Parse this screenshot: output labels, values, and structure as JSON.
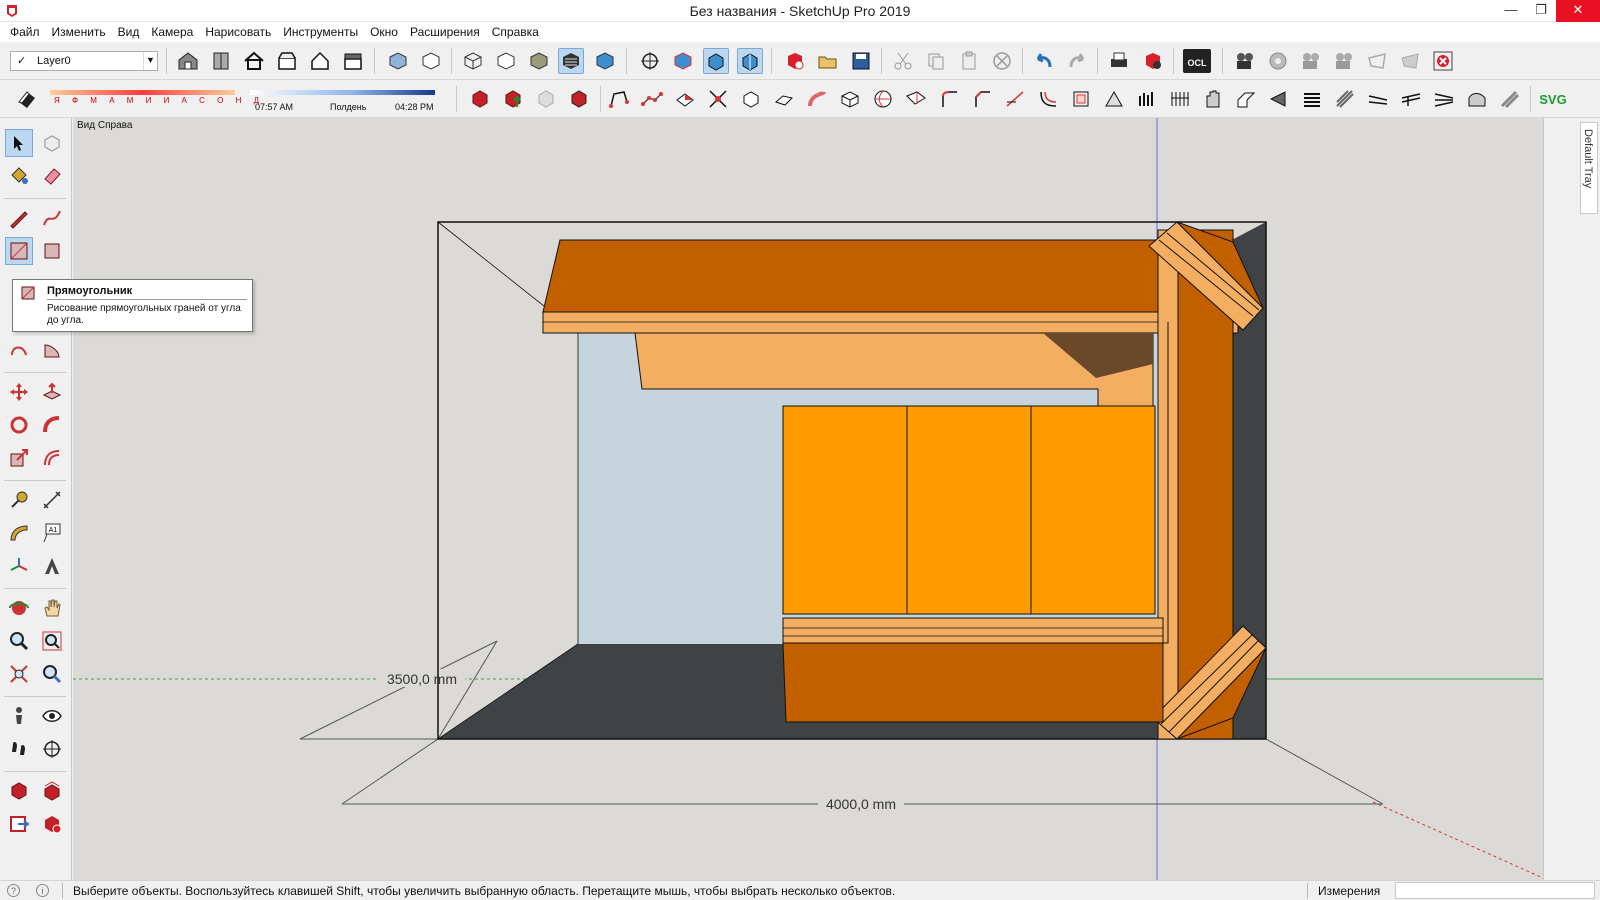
{
  "window": {
    "title": "Без названия - SketchUp Pro 2019",
    "icons": [
      "app-icon",
      "minimize-icon",
      "maximize-icon",
      "close-icon"
    ]
  },
  "menu": {
    "items": [
      "Файл",
      "Изменить",
      "Вид",
      "Камера",
      "Нарисовать",
      "Инструменты",
      "Окно",
      "Расширения",
      "Справка"
    ]
  },
  "layer": {
    "current": "Layer0",
    "check": "✓"
  },
  "shadows": {
    "months": "Я Ф М А М И И А С О Н Д",
    "time_start": "07:57 AM",
    "time_mid": "Полдень",
    "time_end": "04:28 PM"
  },
  "viewport": {
    "view_name": "Вид Справа",
    "dim_depth": "3500,0 mm",
    "dim_width": "4000,0 mm",
    "colors": {
      "background": "#dcdad6",
      "floor": "#3f4346",
      "wall": "#c5d4dd",
      "wood_dark": "#c26000",
      "wood_light": "#f4ae62",
      "door_orange": "#ff9a00",
      "axis_blue": "#6b6bd8",
      "axis_green": "#3aa34a",
      "axis_red": "#d33"
    }
  },
  "tooltip": {
    "title": "Прямоугольник",
    "description": "Рисование прямоугольных граней от угла до угла."
  },
  "tray": {
    "tab_label": "Default Tray"
  },
  "toolbar": {
    "svg_label": "SVG",
    "ocl_label": "OCL"
  },
  "status": {
    "message": "Выберите объекты. Воспользуйтесь клавишей Shift, чтобы увеличить выбранную область. Перетащите мышь, чтобы выбрать несколько объектов.",
    "measurements_label": "Измерения",
    "measurements_value": ""
  }
}
